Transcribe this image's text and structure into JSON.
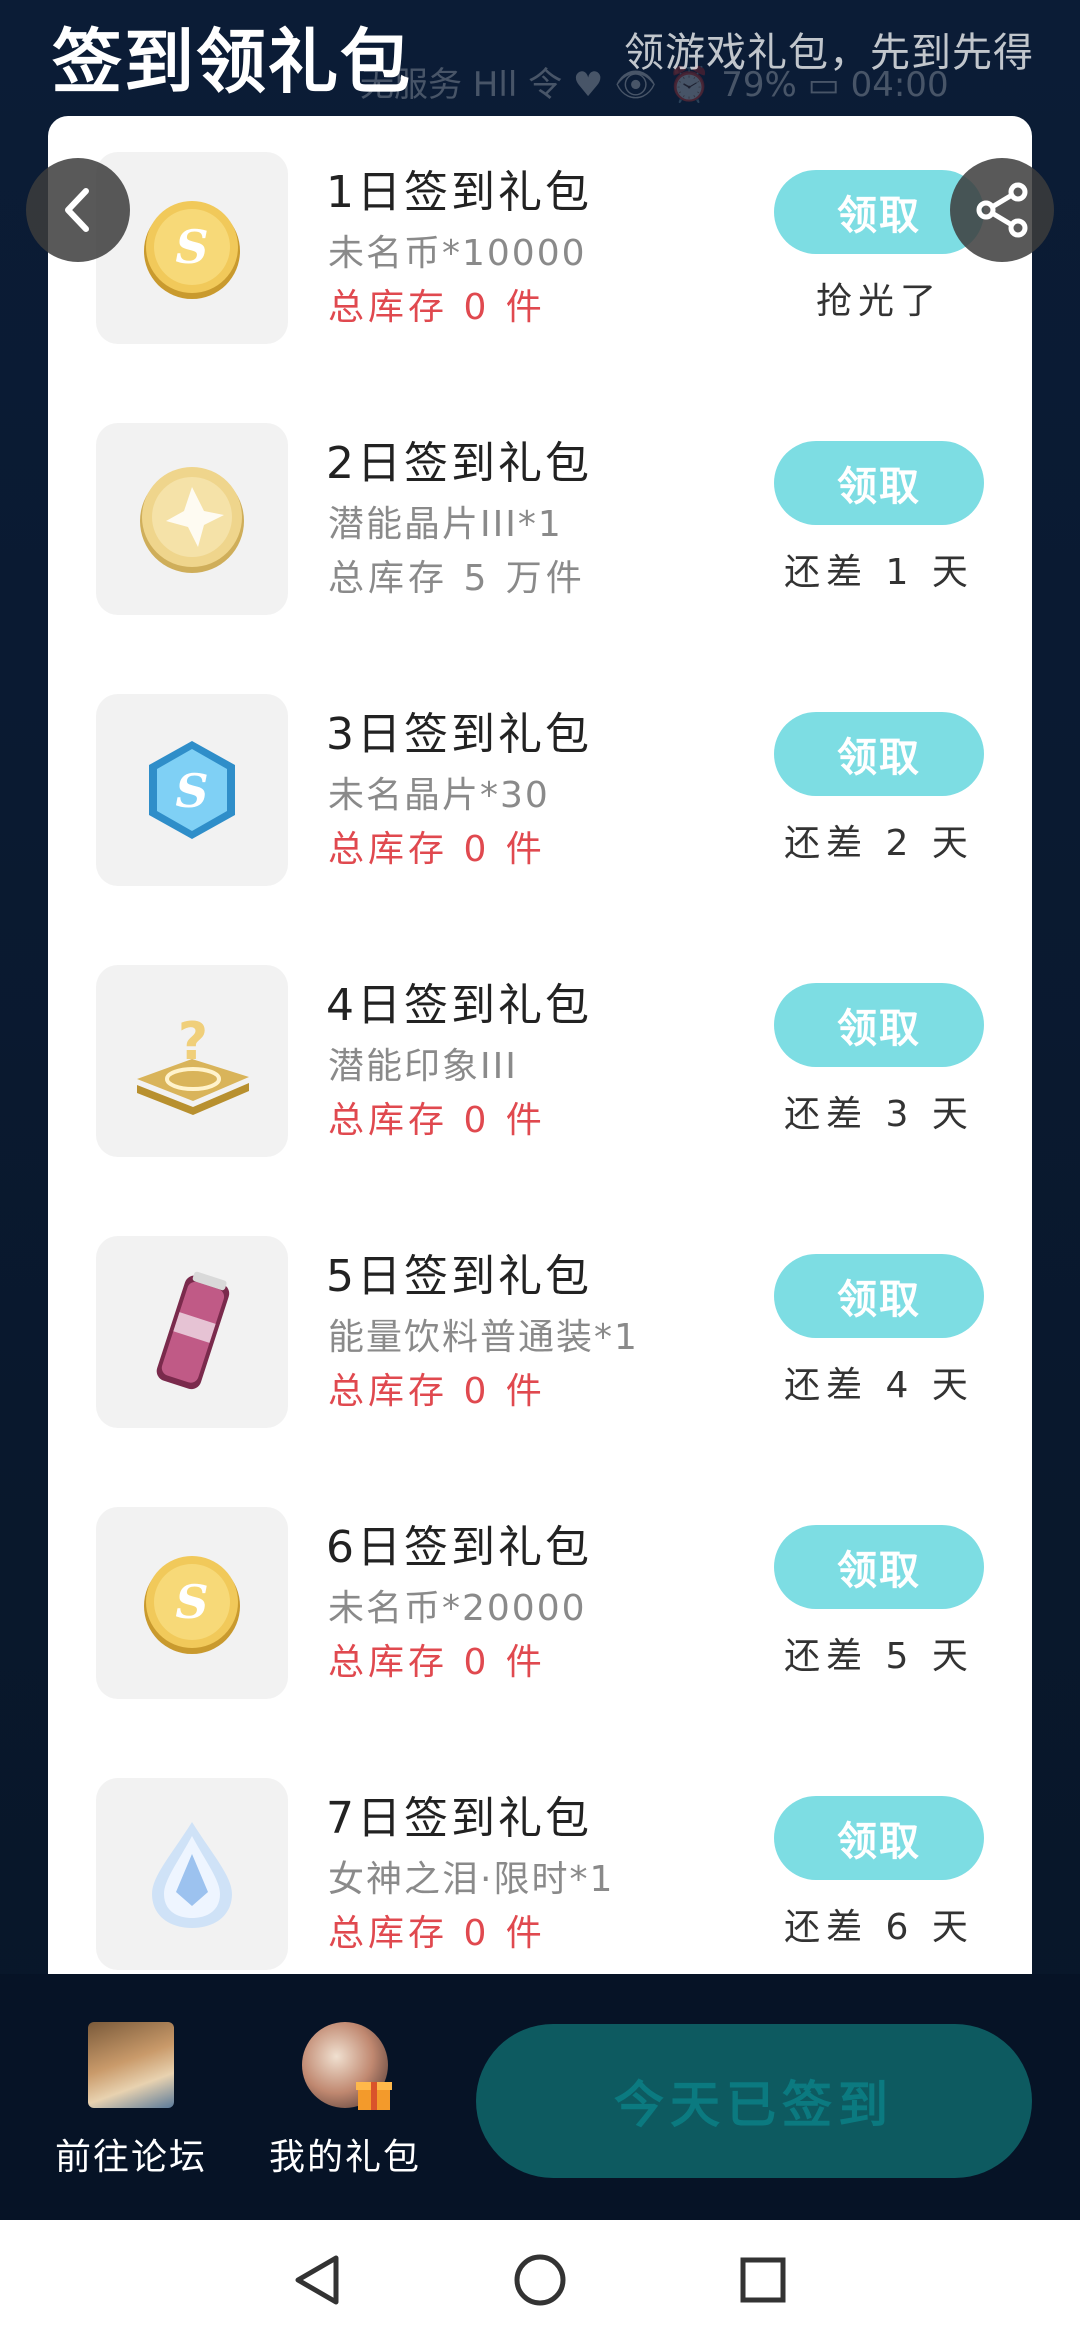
{
  "header": {
    "title": "签到领礼包",
    "subtitle": "领游戏礼包，先到先得",
    "status_text": "无服务 Hll 令 ♥   👁 ⏰ 79% ▭ 04:00"
  },
  "rewards": [
    {
      "title": "1日签到礼包",
      "desc": "未名币*10000",
      "stock": "总库存 0 件",
      "stock_color": "#e0494f",
      "button": "领取",
      "note": "抢光了",
      "icon": "gold-coin-icon"
    },
    {
      "title": "2日签到礼包",
      "desc": "潜能晶片III*1",
      "stock": "总库存 5 万件",
      "stock_color": "#8a8a8a",
      "button": "领取",
      "note": "还差 1 天",
      "icon": "potential-chip-coin-icon"
    },
    {
      "title": "3日签到礼包",
      "desc": "未名晶片*30",
      "stock": "总库存 0 件",
      "stock_color": "#e0494f",
      "button": "领取",
      "note": "还差 2 天",
      "icon": "blue-crystal-icon"
    },
    {
      "title": "4日签到礼包",
      "desc": "潜能印象III",
      "stock": "总库存 0 件",
      "stock_color": "#e0494f",
      "button": "领取",
      "note": "还差 3 天",
      "icon": "mystery-card-icon"
    },
    {
      "title": "5日签到礼包",
      "desc": "能量饮料普通装*1",
      "stock": "总库存 0 件",
      "stock_color": "#e0494f",
      "button": "领取",
      "note": "还差 4 天",
      "icon": "energy-drink-icon"
    },
    {
      "title": "6日签到礼包",
      "desc": "未名币*20000",
      "stock": "总库存 0 件",
      "stock_color": "#e0494f",
      "button": "领取",
      "note": "还差 5 天",
      "icon": "gold-coin-icon"
    },
    {
      "title": "7日签到礼包",
      "desc": "女神之泪·限时*1",
      "stock": "总库存 0 件",
      "stock_color": "#e0494f",
      "button": "领取",
      "note": "还差 6 天",
      "icon": "tear-crystal-icon"
    }
  ],
  "bottom": {
    "forum_label": "前往论坛",
    "gifts_label": "我的礼包",
    "signed_label": "今天已签到"
  },
  "colors": {
    "claim_button": "#7ddde3",
    "signed_button": "#0d5a60",
    "out_of_stock_text": "#e0494f"
  }
}
